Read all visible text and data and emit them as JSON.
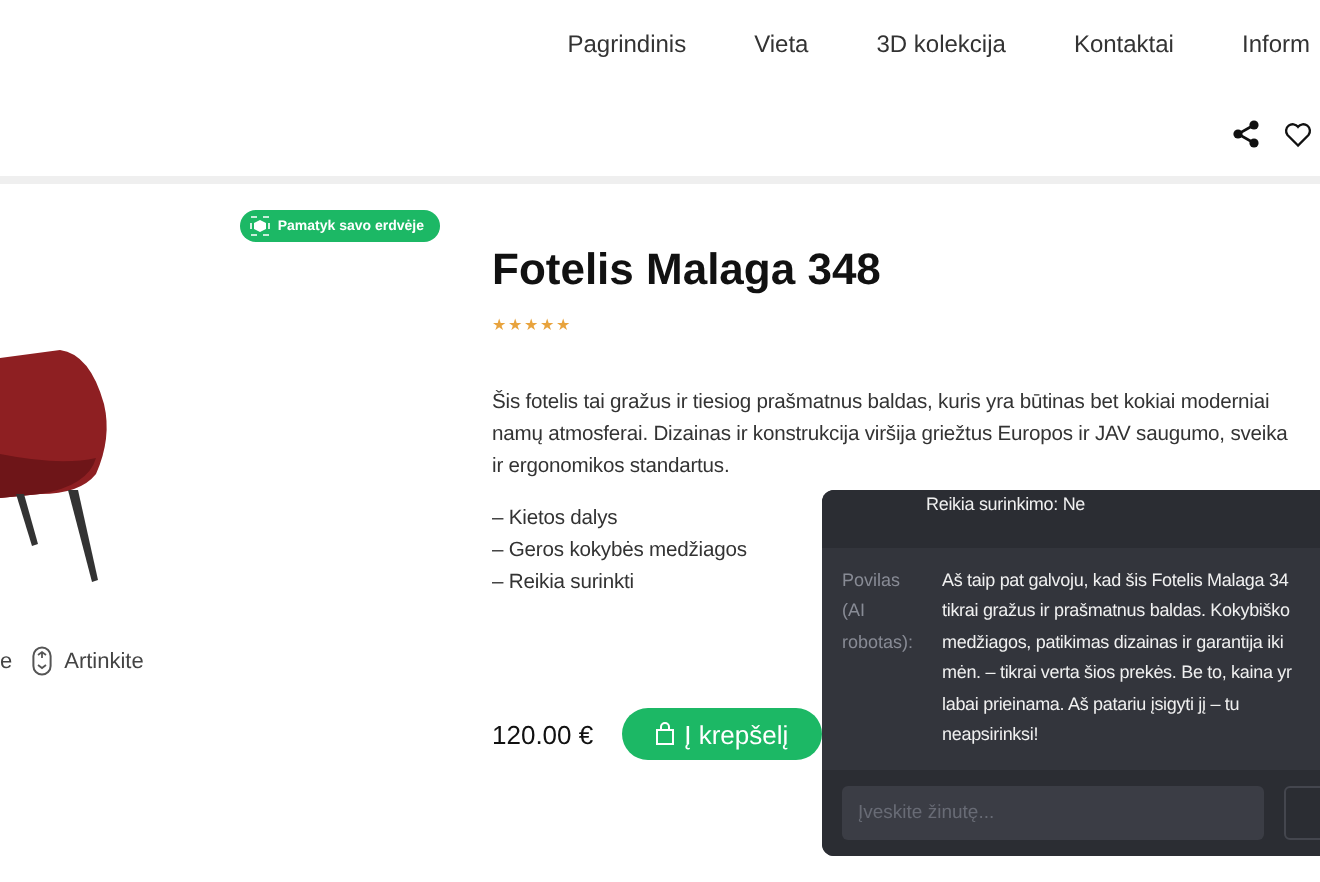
{
  "nav": {
    "items": [
      {
        "label": "Pagrindinis"
      },
      {
        "label": "Vieta"
      },
      {
        "label": "3D kolekcija"
      },
      {
        "label": "Kontaktai"
      },
      {
        "label": "Inform"
      }
    ]
  },
  "viewer": {
    "badge": "Pamatyk savo erdvėje",
    "hints": [
      {
        "kind": "text",
        "label": "e"
      },
      {
        "kind": "mouse",
        "label": "Artinkite"
      }
    ]
  },
  "product": {
    "title": "Fotelis Malaga 348",
    "stars": 5,
    "description_lines": [
      "Šis fotelis tai gražus ir tiesiog prašmatnus baldas, kuris yra būtinas bet kokiai moderniai",
      "namų atmosferai. Dizainas ir konstrukcija viršija griežtus Europos ir JAV saugumo, sveika",
      "ir ergonomikos standartus."
    ],
    "features": [
      "– Kietos dalys",
      "– Geros kokybės medžiagos",
      "– Reikia surinkti"
    ],
    "price": "120.00 €",
    "cart_button": "Į krepšelį"
  },
  "chat": {
    "previous_line": "Reikia surinkimo: Ne",
    "messages": [
      {
        "author": "Povilas (AI robotas):",
        "lines": [
          "Aš taip pat galvoju, kad šis Fotelis Malaga 34",
          "tikrai gražus ir prašmatnus baldas. Kokybiško",
          "medžiagos, patikimas dizainas ir garantija iki",
          "mėn. – tikrai verta šios prekės. Be to, kaina yr",
          "labai prieinama. Aš patariu įsigyti jį – tu",
          "neapsirinksi!"
        ]
      }
    ],
    "input": {
      "placeholder": "Įveskite žinutę..."
    }
  }
}
